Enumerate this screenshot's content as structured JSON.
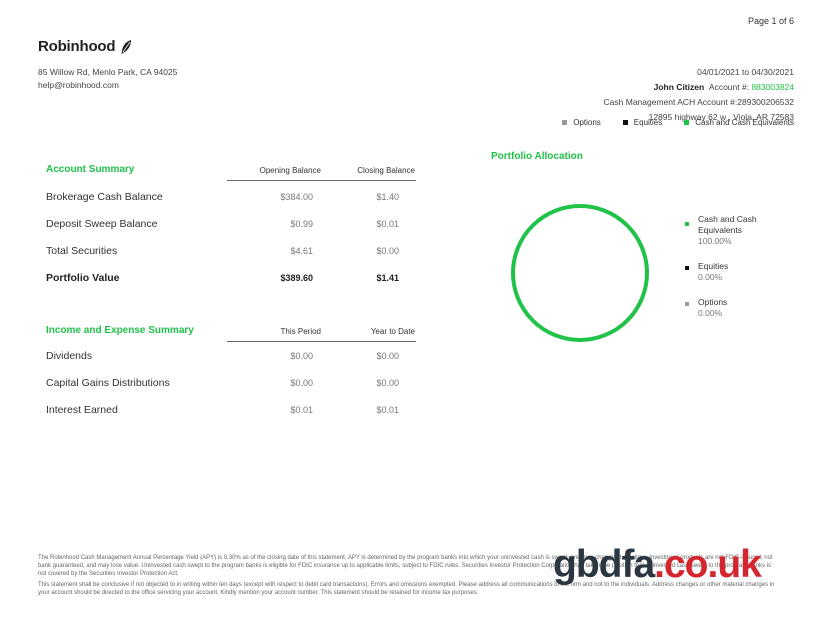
{
  "page_indicator": "Page 1 of 6",
  "brand": {
    "name": "Robinhood",
    "address": "85 Willow Rd, Menlo Park, CA 94025",
    "email": "help@robinhood.com"
  },
  "account": {
    "period": "04/01/2021 to 04/30/2021",
    "holder": "John Citizen",
    "account_label": "Account #:",
    "account_number": "883003824",
    "cash_mgmt": "Cash Management ACH Account #:289300206532",
    "address": "12895 highway 62 w , Viola, AR 72583"
  },
  "legend_top": [
    {
      "label": "Options",
      "color": "#999999"
    },
    {
      "label": "Equities",
      "color": "#111111"
    },
    {
      "label": "Cash and Cash Equivalents",
      "color": "#21c24a"
    }
  ],
  "account_summary": {
    "title": "Account Summary",
    "col1": "Opening Balance",
    "col2": "Closing Balance",
    "rows": [
      {
        "label": "Brokerage Cash Balance",
        "v1": "$384.00",
        "v2": "$1.40"
      },
      {
        "label": "Deposit Sweep Balance",
        "v1": "$0.99",
        "v2": "$0.01"
      },
      {
        "label": "Total Securities",
        "v1": "$4.61",
        "v2": "$0.00"
      },
      {
        "label": "Portfolio Value",
        "v1": "$389.60",
        "v2": "$1.41"
      }
    ]
  },
  "income_summary": {
    "title": "Income and Expense Summary",
    "col1": "This Period",
    "col2": "Year to Date",
    "rows": [
      {
        "label": "Dividends",
        "v1": "$0.00",
        "v2": "$0.00"
      },
      {
        "label": "Capital Gains Distributions",
        "v1": "$0.00",
        "v2": "$0.00"
      },
      {
        "label": "Interest Earned",
        "v1": "$0.01",
        "v2": "$0.01"
      }
    ]
  },
  "portfolio_allocation": {
    "title": "Portfolio Allocation",
    "items": [
      {
        "label": "Cash and Cash Equivalents",
        "pct": "100.00%",
        "color": "#21c24a"
      },
      {
        "label": "Equities",
        "pct": "0.00%",
        "color": "#111111"
      },
      {
        "label": "Options",
        "pct": "0.00%",
        "color": "#999999"
      }
    ]
  },
  "footer": {
    "p1": "The Robinhood Cash Management Annual Percentage Yield (APY) is 0.30% as of the closing date of this statement. APY is determined by the program banks into which your uninvested cash is swept, and may change at any time. Investment products are not FDIC-insured, not bank guaranteed, and may lose value. Uninvested cash swept to the program banks is eligible for FDIC insurance up to applicable limits, subject to FDIC rules. Securities Investor Protection Corporation has taken the position that uninvested cash swept to the program banks is not covered by the Securities Investor Protection Act.",
    "p2": "This statement shall be conclusive if not objected to in writing within ten days (except with respect to debit card transactions). Errors and omissions exempted. Please address all communications to the firm and not to the individuals. Address changes or other material changes in your account should be directed to the office servicing your account. Kindly mention your account number. This statement should be retained for income tax purposes."
  },
  "watermark": {
    "part1": "gbdfa",
    "part2": ".co.uk"
  }
}
